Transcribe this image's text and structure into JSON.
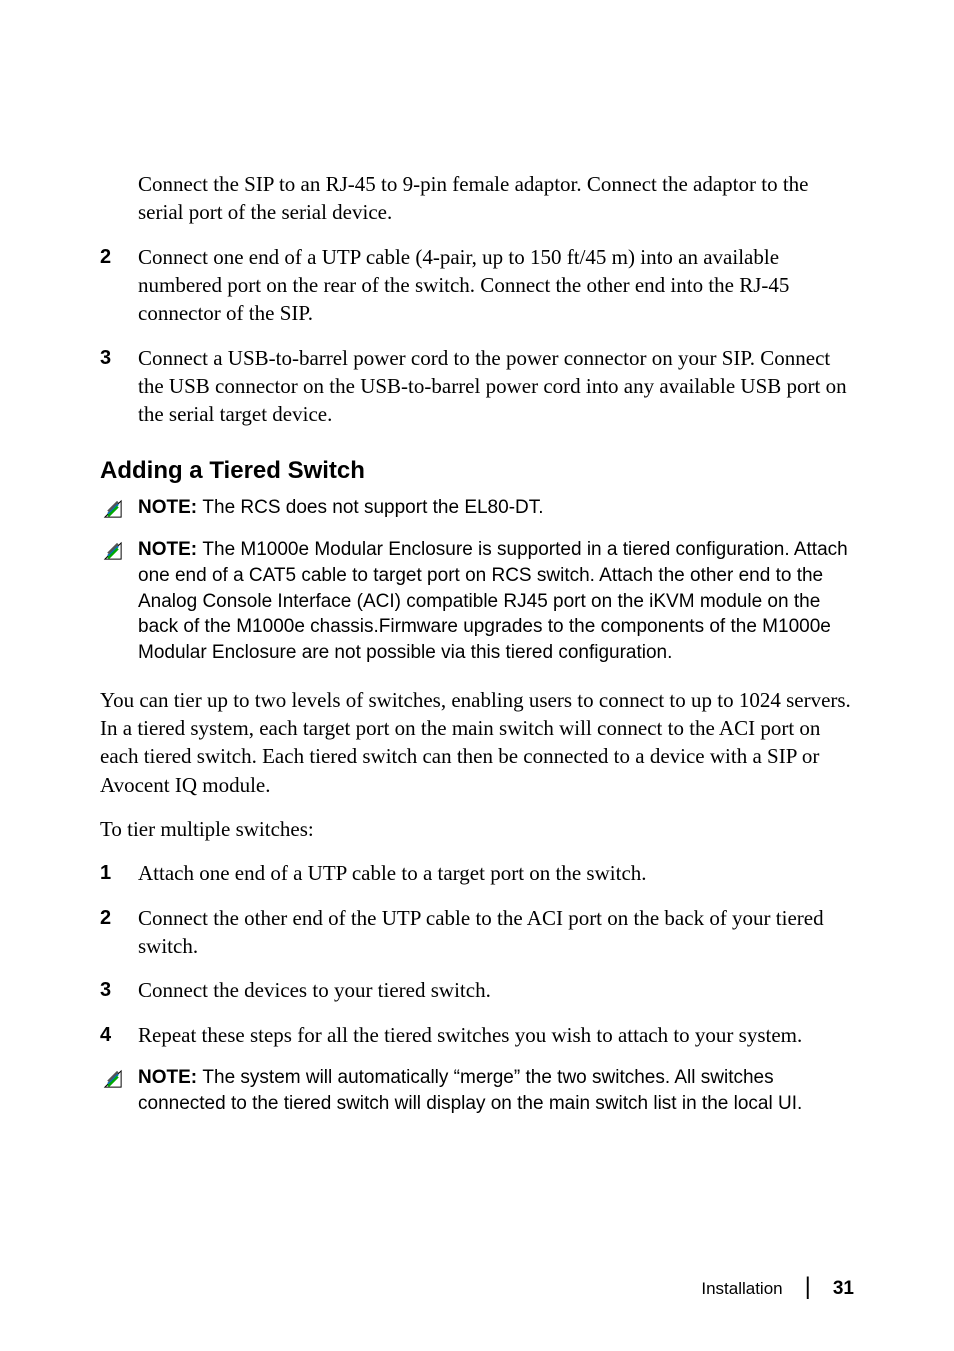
{
  "p1": "Connect the SIP to an RJ-45 to 9-pin female adaptor. Connect the adaptor to the serial port of the serial device.",
  "list1": [
    {
      "num": "2",
      "text": "Connect one end of a UTP cable (4-pair, up to 150 ft/45 m) into an available numbered port on the rear of the switch. Connect the other end into the RJ-45 connector of the SIP."
    },
    {
      "num": "3",
      "text": "Connect a USB-to-barrel power cord to the power connector on your SIP. Connect the USB connector on the USB-to-barrel power cord into any available USB port on the serial target device."
    }
  ],
  "heading": "Adding a Tiered Switch",
  "note1_label": "NOTE: ",
  "note1_text": "The RCS does not support the EL80-DT.",
  "note2_label": "NOTE: ",
  "note2_text": "The M1000e Modular Enclosure is supported in a tiered configuration. Attach one end of a CAT5 cable to target port on RCS switch. Attach the other end to the Analog Console Interface (ACI) compatible RJ45 port on the iKVM module on the back of the M1000e chassis.Firmware upgrades to the components of the M1000e Modular Enclosure are not possible via this tiered configuration.",
  "p2": "You can tier up to two levels of switches, enabling users to connect to up to 1024 servers. In a tiered system, each target port on the main switch will connect to the ACI port on each tiered switch. Each tiered switch can then be connected to a device with a SIP or Avocent IQ module.",
  "p3": "To tier multiple switches:",
  "list2": [
    {
      "num": "1",
      "text": "Attach one end of a UTP cable to a target port on the switch."
    },
    {
      "num": "2",
      "text": "Connect the other end of the UTP cable to the ACI port on the back of your tiered switch."
    },
    {
      "num": "3",
      "text": "Connect the devices to your tiered switch."
    },
    {
      "num": "4",
      "text": "Repeat these steps for all the tiered switches you wish to attach to your system."
    }
  ],
  "note3_label": "NOTE: ",
  "note3_text": "The system will automatically “merge” the two switches. All switches connected to the tiered switch will display on the main switch list in the local UI.",
  "footer_section": "Installation",
  "footer_page": "31"
}
